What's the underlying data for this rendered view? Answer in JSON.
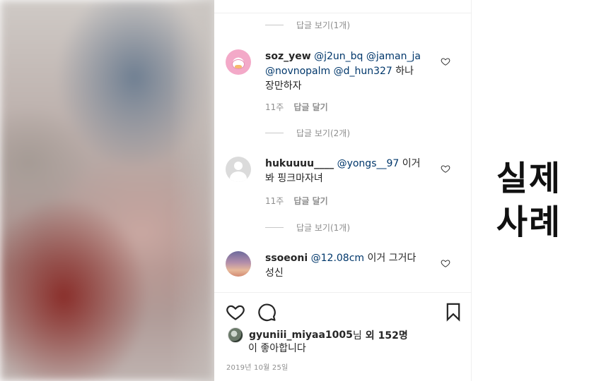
{
  "post": {
    "comments": [
      {
        "username": "soz_yew",
        "mentions": [
          "@j2un_bq",
          "@jaman_ja",
          "@novnopalm",
          "@d_hun327"
        ],
        "text": "하나\n장만하자",
        "time": "11주",
        "reply_label": "답글 달기",
        "avatar": "pink-duck-avatar"
      },
      {
        "username": "hukuuuu____",
        "mentions": [
          "@yongs__97"
        ],
        "text": "이거\n봐 핑크마자녀",
        "time": "11주",
        "reply_label": "답글 달기",
        "avatar": "default-avatar"
      },
      {
        "username": "ssoeoni",
        "mentions": [
          "@12.08cm"
        ],
        "text": "이거 그거다\n성신",
        "avatar": "sunset-avatar"
      }
    ],
    "view_replies": [
      "답글 보기(1개)",
      "답글 보기(2개)",
      "답글 보기(1개)"
    ],
    "likes": {
      "liker": "gyuniii_miyaa1005",
      "suffix": "님",
      "other_prefix": "외",
      "count": "152명",
      "tail": "이 좋아합니다"
    },
    "date": "2019년 10월 25일"
  },
  "side_label": {
    "line1": "실제",
    "line2": "사례"
  },
  "colors": {
    "mention": "#00376b",
    "muted": "#8e8e8e",
    "text": "#262626",
    "divider": "#efefef"
  },
  "icons": {
    "comment_like": "heart-outline-icon",
    "post_like": "heart-icon",
    "post_comment": "comment-bubble-icon",
    "post_save": "bookmark-icon"
  }
}
